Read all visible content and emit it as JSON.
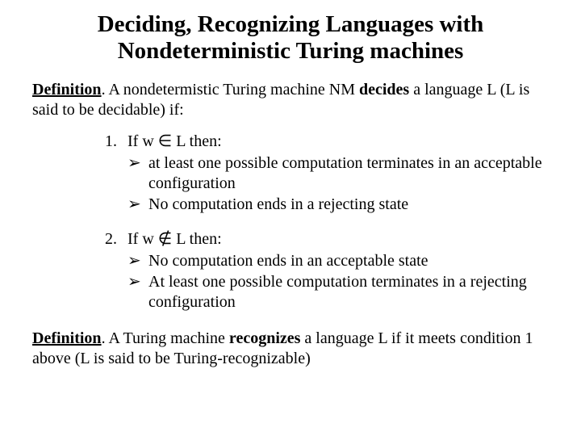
{
  "title": "Deciding, Recognizing Languages with Nondeterministic Turing machines",
  "def1": {
    "label": "Definition",
    "text_a": ". A nondetermistic Turing machine NM  ",
    "bold": "decides",
    "text_b": " a language L (L is said to be decidable) if:"
  },
  "items": [
    {
      "num": "1.",
      "cond_a": "If w ",
      "sym": "∈",
      "cond_b": " L then:",
      "subs": [
        {
          "arrow": "➢",
          "text": " at least one possible computation terminates in an acceptable configuration"
        },
        {
          "arrow": "➢",
          "text": "No computation ends in a rejecting state"
        }
      ]
    },
    {
      "num": "2.",
      "cond_a": "If w ",
      "sym": "∉",
      "cond_b": " L then:",
      "subs": [
        {
          "arrow": "➢",
          "text": " No computation ends in an acceptable state"
        },
        {
          "arrow": "➢",
          "text": " At least one possible computation terminates in a rejecting configuration"
        }
      ]
    }
  ],
  "def2": {
    "label": "Definition",
    "text_a": ". A Turing machine ",
    "bold": "recognizes",
    "text_b": " a language L if it meets condition 1 above (L is said to be Turing-recognizable)"
  }
}
